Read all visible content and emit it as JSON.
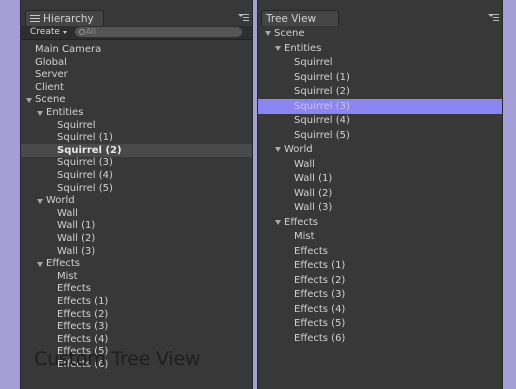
{
  "hierarchy": {
    "tab_title": "Hierarchy",
    "create_label": "Create",
    "search_placeholder": "All",
    "items": [
      {
        "label": "Main Camera",
        "depth": 0
      },
      {
        "label": "Global",
        "depth": 0
      },
      {
        "label": "Server",
        "depth": 0
      },
      {
        "label": "Client",
        "depth": 0
      },
      {
        "label": "Scene",
        "depth": 0,
        "expanded": true
      },
      {
        "label": "Entities",
        "depth": 1,
        "expanded": true
      },
      {
        "label": "Squirrel",
        "depth": 2
      },
      {
        "label": "Squirrel (1)",
        "depth": 2
      },
      {
        "label": "Squirrel (2)",
        "depth": 2,
        "selected": true
      },
      {
        "label": "Squirrel (3)",
        "depth": 2
      },
      {
        "label": "Squirrel (4)",
        "depth": 2
      },
      {
        "label": "Squirrel (5)",
        "depth": 2
      },
      {
        "label": "World",
        "depth": 1,
        "expanded": true
      },
      {
        "label": "Wall",
        "depth": 2
      },
      {
        "label": "Wall (1)",
        "depth": 2
      },
      {
        "label": "Wall (2)",
        "depth": 2
      },
      {
        "label": "Wall (3)",
        "depth": 2
      },
      {
        "label": "Effects",
        "depth": 1,
        "expanded": true
      },
      {
        "label": "Mist",
        "depth": 2
      },
      {
        "label": "Effects",
        "depth": 2
      },
      {
        "label": "Effects (1)",
        "depth": 2
      },
      {
        "label": "Effects (2)",
        "depth": 2
      },
      {
        "label": "Effects (3)",
        "depth": 2
      },
      {
        "label": "Effects (4)",
        "depth": 2
      },
      {
        "label": "Effects (5)",
        "depth": 2
      },
      {
        "label": "Effects (6)",
        "depth": 2
      }
    ]
  },
  "tree_view": {
    "tab_title": "Tree View",
    "items": [
      {
        "label": "Scene",
        "depth": 0,
        "expanded": true
      },
      {
        "label": "Entities",
        "depth": 1,
        "expanded": true
      },
      {
        "label": "Squirrel",
        "depth": 2
      },
      {
        "label": "Squirrel (1)",
        "depth": 2
      },
      {
        "label": "Squirrel (2)",
        "depth": 2
      },
      {
        "label": "Squirrel (3)",
        "depth": 2,
        "selected": true
      },
      {
        "label": "Squirrel (4)",
        "depth": 2
      },
      {
        "label": "Squirrel (5)",
        "depth": 2
      },
      {
        "label": "World",
        "depth": 1,
        "expanded": true
      },
      {
        "label": "Wall",
        "depth": 2
      },
      {
        "label": "Wall (1)",
        "depth": 2
      },
      {
        "label": "Wall (2)",
        "depth": 2
      },
      {
        "label": "Wall (3)",
        "depth": 2
      },
      {
        "label": "Effects",
        "depth": 1,
        "expanded": true
      },
      {
        "label": "Mist",
        "depth": 2
      },
      {
        "label": "Effects",
        "depth": 2
      },
      {
        "label": "Effects (1)",
        "depth": 2
      },
      {
        "label": "Effects (2)",
        "depth": 2
      },
      {
        "label": "Effects (3)",
        "depth": 2
      },
      {
        "label": "Effects (4)",
        "depth": 2
      },
      {
        "label": "Effects (5)",
        "depth": 2
      },
      {
        "label": "Effects (6)",
        "depth": 2
      }
    ]
  },
  "caption": "Custom Tree View",
  "colors": {
    "background": "#a59fd8",
    "panel": "#383838",
    "selection_gray": "#4a4a4a",
    "selection_blue": "#8a85f0"
  }
}
